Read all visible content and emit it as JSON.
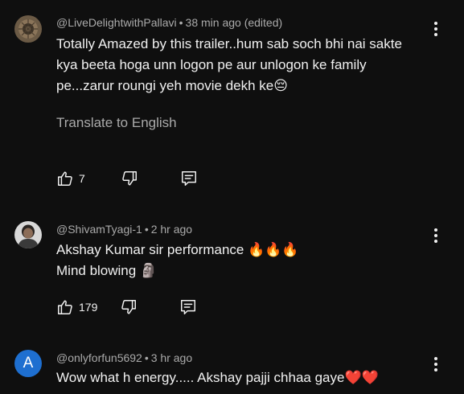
{
  "comments": [
    {
      "author": "@LiveDelightwithPallavi",
      "time": "38 min ago (edited)",
      "lines": [
        "Totally Amazed by this trailer..hum sab soch bhi nai sakte",
        "kya beeta hoga unn logon pe aur unlogon ke family",
        "pe...zarur roungi yeh movie dekh ke😔"
      ],
      "translate": "Translate to English",
      "likes": "7",
      "avatar": "image"
    },
    {
      "author": "@ShivamTyagi-1",
      "time": "2 hr ago",
      "lines": [
        "Akshay Kumar sir performance 🔥🔥🔥",
        "Mind blowing 🗿"
      ],
      "likes": "179",
      "avatar": "image"
    },
    {
      "author": "@onlyforfun5692",
      "time": "3 hr ago",
      "lines": [
        "Wow what h energy..... Akshay pajji chhaa gaye❤️❤️"
      ],
      "avatar_letter": "A",
      "avatar_color": "#1e6fd0"
    }
  ],
  "icons": {
    "like": "thumbs-up-icon",
    "dislike": "thumbs-down-icon",
    "reply": "reply-icon",
    "more": "more-vertical-icon"
  }
}
